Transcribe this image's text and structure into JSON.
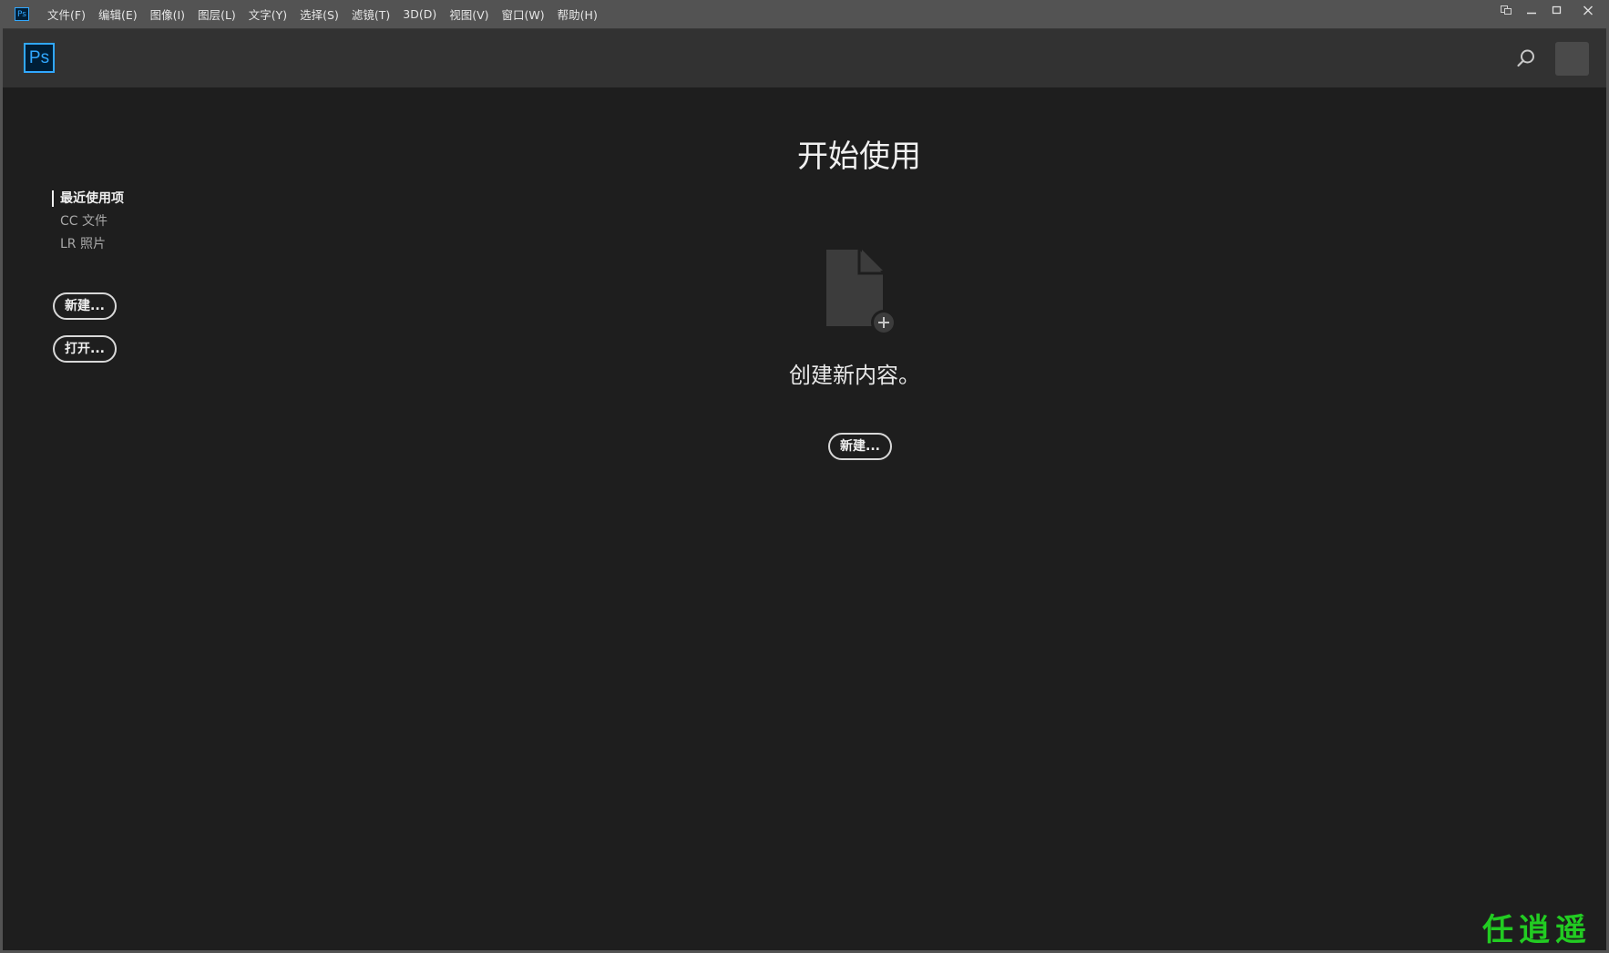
{
  "app": {
    "small_icon_label": "Ps",
    "logo_label": "Ps"
  },
  "menubar": {
    "items": [
      "文件(F)",
      "编辑(E)",
      "图像(I)",
      "图层(L)",
      "文字(Y)",
      "选择(S)",
      "滤镜(T)",
      "3D(D)",
      "视图(V)",
      "窗口(W)",
      "帮助(H)"
    ]
  },
  "window_controls": {
    "icons": [
      "arrange-icon",
      "minimize-icon",
      "maximize-icon",
      "close-icon"
    ]
  },
  "header": {
    "search_icon": "search-icon",
    "avatar": "user-avatar"
  },
  "sidebar": {
    "nav": [
      {
        "label": "最近使用项",
        "active": true
      },
      {
        "label": "CC 文件",
        "active": false
      },
      {
        "label": "LR 照片",
        "active": false
      }
    ],
    "new_button": "新建...",
    "open_button": "打开..."
  },
  "main": {
    "title": "开始使用",
    "empty_icon": "new-document-icon",
    "empty_text": "创建新内容。",
    "new_button": "新建..."
  },
  "colors": {
    "background": "#1e1e1e",
    "menubar": "#535353",
    "header": "#323232",
    "ps_blue": "#31a8ff",
    "ps_navy": "#001e36",
    "watermark_green": "#22cc22"
  },
  "watermark": {
    "text": "任逍遥"
  }
}
